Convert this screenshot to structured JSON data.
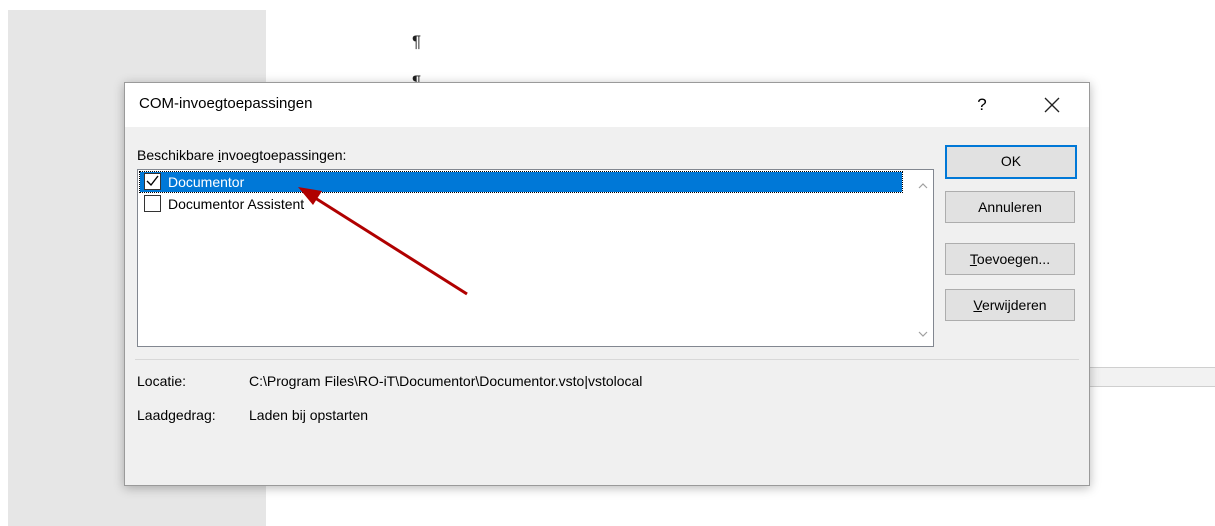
{
  "background": {
    "pilcrow": "¶",
    "pilcrow2": "¶"
  },
  "dialog": {
    "title": "COM-invoegtoepassingen",
    "help_label": "?",
    "list_label_pre": "Beschikbare ",
    "list_label_accel": "i",
    "list_label_post": "nvoegtoepassingen:",
    "items": [
      {
        "label": "Documentor",
        "checked": true,
        "selected": true
      },
      {
        "label": "Documentor Assistent",
        "checked": false,
        "selected": false
      }
    ],
    "buttons": {
      "ok": "OK",
      "cancel": "Annuleren",
      "add_accel": "T",
      "add_rest": "oevoegen...",
      "remove_accel": "V",
      "remove_rest": "erwijderen"
    },
    "location_label": "Locatie:",
    "location_value": "C:\\Program Files\\RO-iT\\Documentor\\Documentor.vsto|vstolocal",
    "load_behavior_label": "Laadgedrag:",
    "load_behavior_value": "Laden bij opstarten"
  },
  "colors": {
    "selection": "#0078d7",
    "arrow": "#b00000",
    "dialog_bg": "#f0f0f0"
  }
}
